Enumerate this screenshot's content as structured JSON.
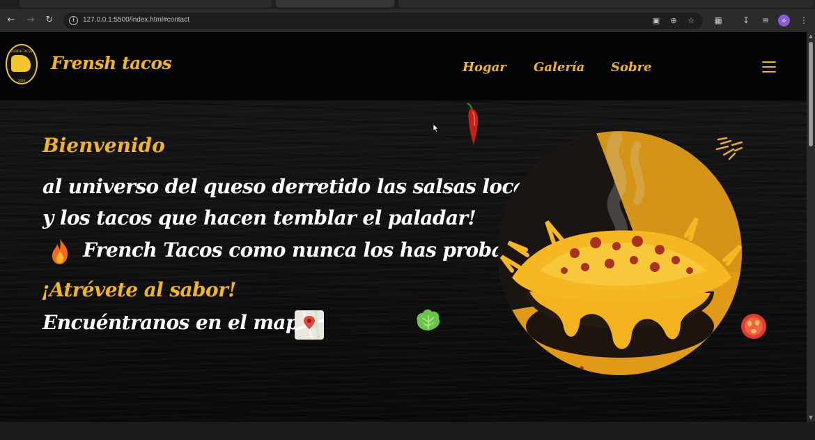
{
  "browser": {
    "url": "127.0.0.1:5500/index.html#contact"
  },
  "header": {
    "brand": "Frensh tacos",
    "nav": [
      "Hogar",
      "Galería",
      "Sobre"
    ]
  },
  "hero": {
    "welcome": "Bienvenido",
    "line1": "al universo del queso derretido las salsas locas",
    "line2": "y los tacos que hacen temblar el paladar!",
    "line3": "French Tacos como nunca los has probado..",
    "dare": "¡Atrévete al sabor!",
    "map_text": "Encuéntranos en el mapa"
  },
  "icons": {
    "menu": "hamburger-icon",
    "fire": "fire-icon",
    "map": "map-pin-icon"
  },
  "colors": {
    "accent": "#f0b429",
    "background": "#0c0c0c",
    "text": "#ffffff"
  }
}
